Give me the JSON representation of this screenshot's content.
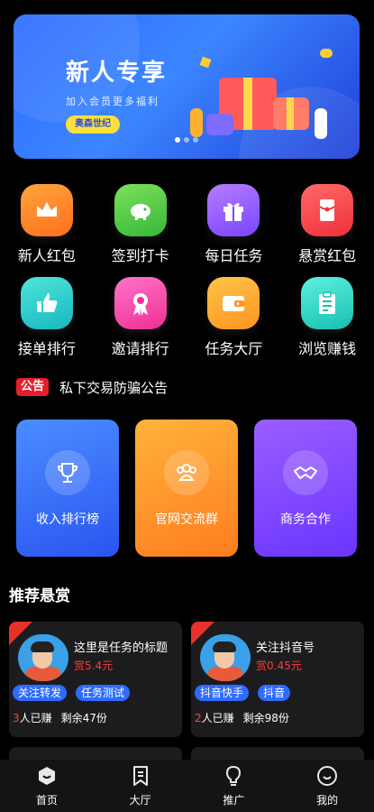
{
  "banner": {
    "title": "新人专享",
    "subtitle": "加入会员更多福利",
    "tag": "奥森世纪"
  },
  "grid": [
    {
      "label": "新人红包",
      "icon": "crown-icon",
      "color": "#ff8a2b"
    },
    {
      "label": "签到打卡",
      "icon": "piggy-bank-icon",
      "color": "#4fd04a"
    },
    {
      "label": "每日任务",
      "icon": "gift-box-icon",
      "color": "#9b5cff"
    },
    {
      "label": "悬赏红包",
      "icon": "red-envelope-icon",
      "color": "#ff4d4d"
    },
    {
      "label": "接单排行",
      "icon": "thumbs-up-icon",
      "color": "#22d3c5"
    },
    {
      "label": "邀请排行",
      "icon": "award-ribbon-icon",
      "color": "#ff4fb0"
    },
    {
      "label": "任务大厅",
      "icon": "wallet-icon",
      "color": "#ffae2b"
    },
    {
      "label": "浏览赚钱",
      "icon": "clipboard-icon",
      "color": "#2ed6c6"
    }
  ],
  "notice": {
    "badge": "公告",
    "text": "私下交易防骗公告"
  },
  "cards": [
    {
      "label": "收入排行榜",
      "icon": "trophy-icon"
    },
    {
      "label": "官网交流群",
      "icon": "group-icon"
    },
    {
      "label": "商务合作",
      "icon": "handshake-icon"
    }
  ],
  "section_title": "推荐悬赏",
  "tasks": [
    {
      "title": "这里是任务的标题",
      "reward": "赏5.4元",
      "tags": [
        "关注转发",
        "任务测试"
      ],
      "done_count": "3",
      "done_suffix": "人已赚",
      "remaining": "剩余47份"
    },
    {
      "title": "关注抖音号",
      "reward": "赏0.45元",
      "tags": [
        "抖音快手",
        "抖音"
      ],
      "done_count": "2",
      "done_suffix": "人已赚",
      "remaining": "剩余98份"
    }
  ],
  "nav": [
    {
      "label": "首页",
      "icon": "home-icon"
    },
    {
      "label": "大厅",
      "icon": "bookmark-icon"
    },
    {
      "label": "推广",
      "icon": "lightbulb-icon"
    },
    {
      "label": "我的",
      "icon": "smiley-icon"
    }
  ]
}
